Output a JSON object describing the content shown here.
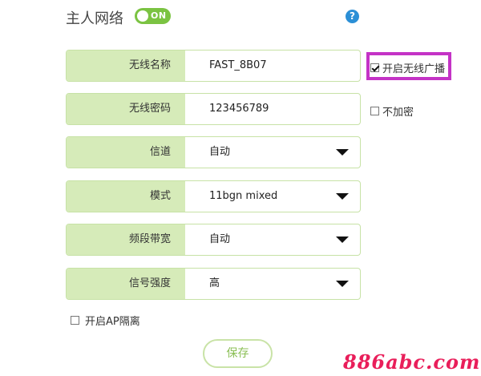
{
  "header": {
    "title": "主人网络",
    "toggle_label": "ON",
    "toggle_state": "on",
    "help_icon": "question-icon",
    "help_label": "?"
  },
  "fields": [
    {
      "label": "无线名称",
      "value": "FAST_8B07",
      "type": "text"
    },
    {
      "label": "无线密码",
      "value": "123456789",
      "type": "text"
    },
    {
      "label": "信道",
      "value": "自动",
      "type": "select"
    },
    {
      "label": "模式",
      "value": "11bgn mixed",
      "type": "select"
    },
    {
      "label": "频段带宽",
      "value": "自动",
      "type": "select"
    },
    {
      "label": "信号强度",
      "value": "高",
      "type": "select"
    }
  ],
  "options": {
    "broadcast": {
      "label": "开启无线广播",
      "checked": true
    },
    "no_encrypt": {
      "label": "不加密",
      "checked": false
    },
    "ap_isolation": {
      "label": "开启AP隔离",
      "checked": false
    }
  },
  "actions": {
    "save_label": "保存"
  },
  "watermark": "886abc.com",
  "colors": {
    "accent": "#7bc342",
    "label_bg": "#d6ebb9",
    "highlight": "#c433c6",
    "watermark": "#e91e5a"
  }
}
